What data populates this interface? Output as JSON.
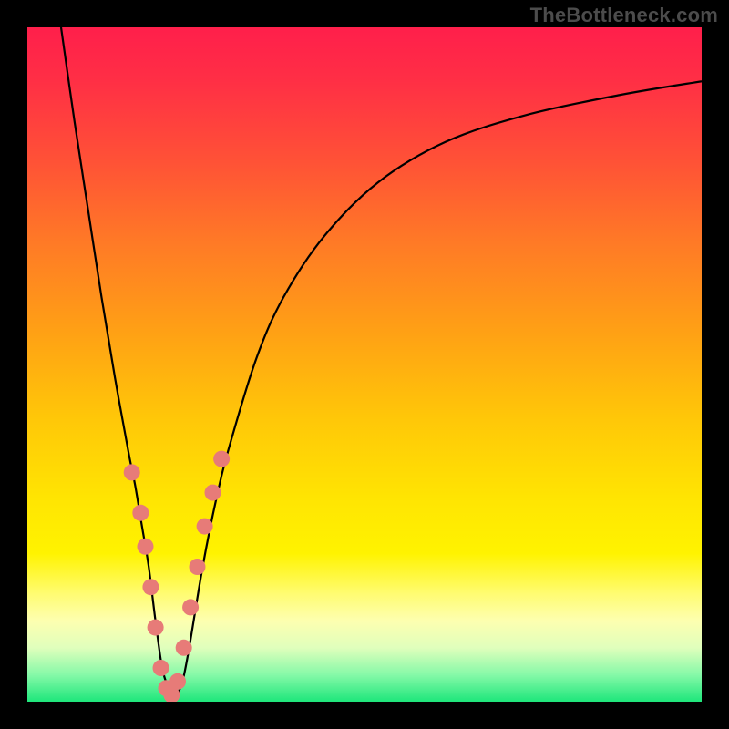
{
  "watermark": "TheBottleneck.com",
  "colors": {
    "frame": "#000000",
    "curve": "#000000",
    "dots": "#e77b78"
  },
  "chart_data": {
    "type": "line",
    "title": "",
    "xlabel": "",
    "ylabel": "",
    "xlim": [
      0,
      100
    ],
    "ylim": [
      0,
      100
    ],
    "series": [
      {
        "name": "bottleneck-curve",
        "x": [
          5,
          7,
          9,
          11,
          13,
          15,
          16,
          17,
          18,
          19,
          20,
          21,
          22,
          23,
          24,
          26,
          28,
          30,
          34,
          38,
          44,
          52,
          62,
          74,
          88,
          100
        ],
        "y": [
          100,
          86,
          73,
          60,
          48,
          37,
          32,
          26,
          20,
          12,
          5,
          2,
          1,
          3,
          8,
          20,
          30,
          38,
          51,
          60,
          69,
          77,
          83,
          87,
          90,
          92
        ]
      }
    ],
    "scatter": [
      {
        "name": "marker-dots",
        "x": [
          15.5,
          16.8,
          17.5,
          18.3,
          19.0,
          19.8,
          20.6,
          21.4,
          22.3,
          23.2,
          24.2,
          25.2,
          26.3,
          27.5,
          28.8
        ],
        "y": [
          34,
          28,
          23,
          17,
          11,
          5,
          2,
          1,
          3,
          8,
          14,
          20,
          26,
          31,
          36
        ]
      }
    ]
  }
}
